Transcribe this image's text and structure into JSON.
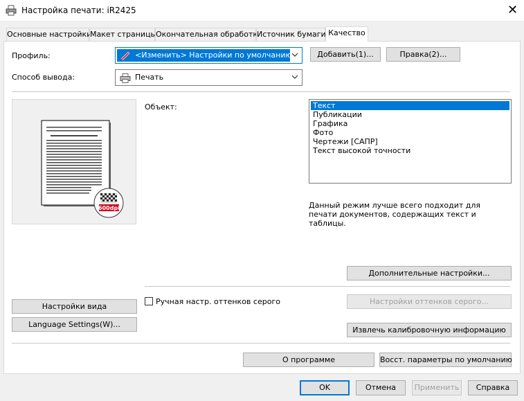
{
  "window": {
    "title": "Настройка печати: iR2425"
  },
  "tabs": [
    {
      "label": "Основные настройки"
    },
    {
      "label": "Макет страницы"
    },
    {
      "label": "Окончательная обработка"
    },
    {
      "label": "Источник бумаги"
    },
    {
      "label": "Качество"
    }
  ],
  "profile": {
    "label": "Профиль:",
    "value": "<Изменить> Настройки по умолчанию",
    "add_button": "Добавить(1)...",
    "edit_button": "Правка(2)..."
  },
  "output": {
    "label": "Способ вывода:",
    "value": "Печать"
  },
  "preview": {
    "dpi_badge": "600dpi"
  },
  "object": {
    "label": "Объект:",
    "items": [
      "Текст",
      "Публикации",
      "Графика",
      "Фото",
      "Чертежи [САПР]",
      "Текст высокой точности"
    ],
    "selected_index": 0
  },
  "description": "Данный режим лучше всего подходит для печати документов, содержащих текст и таблицы.",
  "buttons": {
    "advanced": "Дополнительные настройки...",
    "view_settings": "Настройки вида",
    "language_settings": "Language Settings(W)...",
    "gray_settings": "Настройки оттенков серого...",
    "calibration": "Извлечь калибровочную информацию",
    "about": "О программе",
    "restore_defaults": "Восст. параметры по умолчанию",
    "ok": "OK",
    "cancel": "Отмена",
    "apply": "Применить",
    "help": "Справка"
  },
  "manual_gray": {
    "label": "Ручная настр. оттенков серого",
    "checked": false
  }
}
